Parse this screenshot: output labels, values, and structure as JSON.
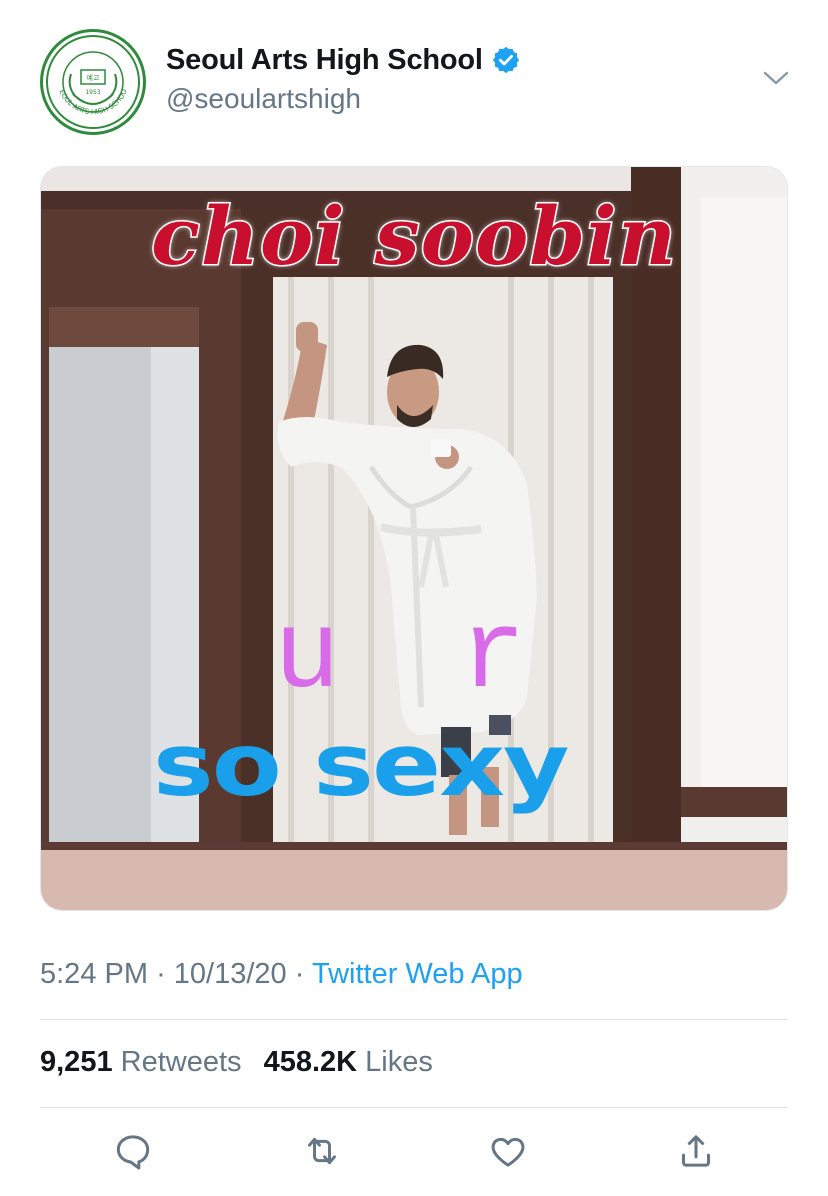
{
  "tweet": {
    "display_name": "Seoul Arts High School",
    "handle": "@seoulartshigh",
    "verified": true,
    "avatar": {
      "ring_text": "SEOUL ARTS HIGH SCHOOL",
      "year": "1953",
      "colors": {
        "ring": "#2f8a3c"
      }
    },
    "image": {
      "caption_top": "choi soobin",
      "caption_middle": "ur",
      "caption_bottom": "so sexy"
    },
    "timestamp": "5:24 PM",
    "date": "10/13/20",
    "separator": "·",
    "source": "Twitter Web App",
    "stats": {
      "retweets_count": "9,251",
      "retweets_label": "Retweets",
      "likes_count": "458.2K",
      "likes_label": "Likes"
    }
  },
  "actions": {
    "reply_icon": "reply-icon",
    "retweet_icon": "retweet-icon",
    "like_icon": "heart-icon",
    "share_icon": "share-icon",
    "more_icon": "chevron-down-icon"
  },
  "colors": {
    "text_primary": "#14171a",
    "text_secondary": "#657786",
    "link": "#1da1f2",
    "verified": "#1da1f2",
    "divider": "#e1e8ed",
    "caption_red": "#c8102e",
    "caption_purple": "#d86be8",
    "caption_blue": "#1aa0ea"
  }
}
